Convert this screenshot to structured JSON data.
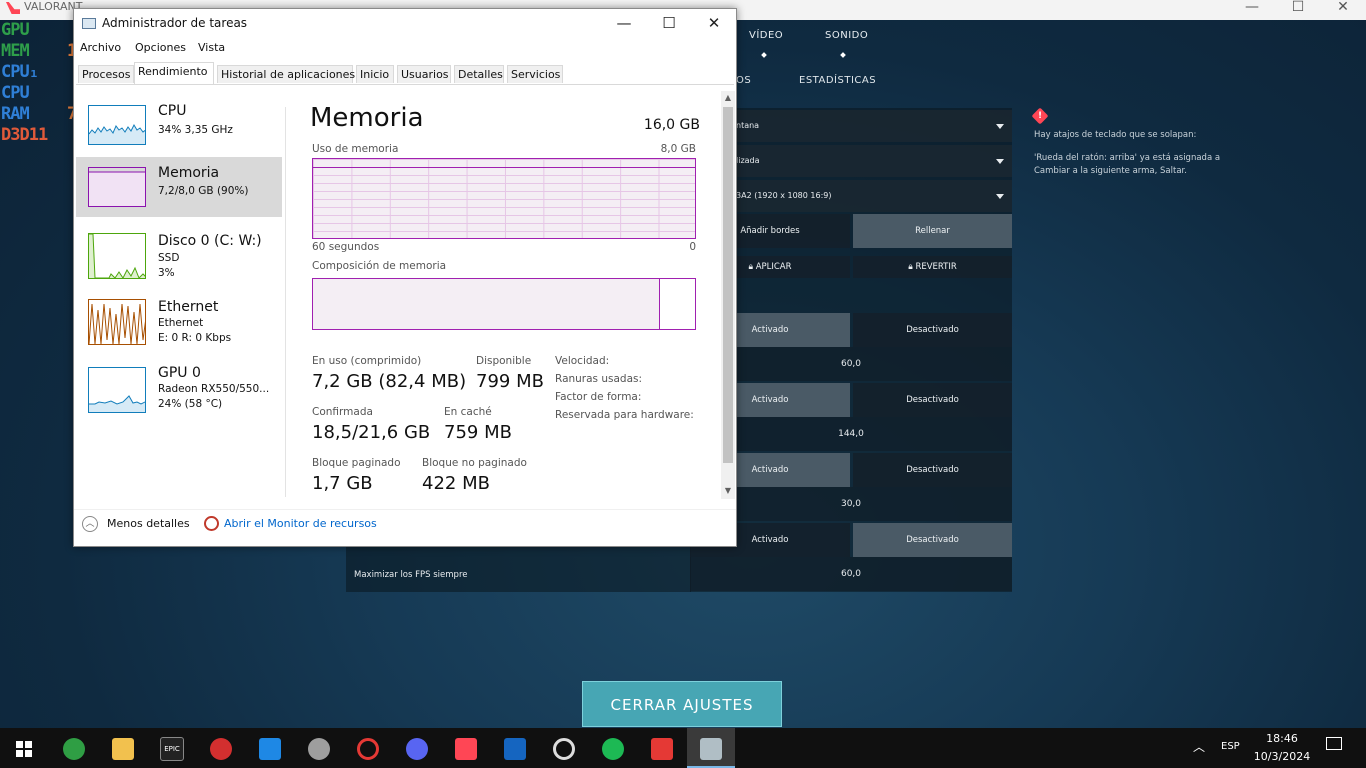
{
  "game": {
    "title": "VALORANT",
    "nav_top": [
      "VÍDEO",
      "SONIDO"
    ],
    "nav_sub": [
      "OS",
      "ESTADÍSTICAS"
    ],
    "dropdowns": [
      "ntana",
      "lizada",
      "3A2 (1920 x  1080 16:9)"
    ],
    "fill_options": {
      "left": "Añadir bordes",
      "right": "Rellenar"
    },
    "apply_label": "APLICAR",
    "revert_label": "REVERTIR",
    "toggle_on": "Activado",
    "toggle_off": "Desactivado",
    "values": [
      "60,0",
      "144,0",
      "30,0",
      "60,0"
    ],
    "max_fps_label": "Maximizar los FPS siempre",
    "warning": {
      "line1": "Hay atajos de teclado que se solapan:",
      "line2": "'Rueda del ratón: arriba' ya está asignada a",
      "line3": "Cambiar a la siguiente arma, Saltar."
    },
    "close_button": "CERRAR AJUSTES",
    "overlay": [
      {
        "label": "GPU",
        "color": "#2e9e4a"
      },
      {
        "label": "MEM",
        "color": "#2e9e4a"
      },
      {
        "label": "CPU₁",
        "color": "#2f7fd6"
      },
      {
        "label": "CPU",
        "color": "#2f7fd6"
      },
      {
        "label": "RAM",
        "color": "#2f7fd6"
      },
      {
        "label": "D3D11",
        "color": "#e05a3a"
      }
    ],
    "overlay_digit_1": "1",
    "overlay_digit_2": "7"
  },
  "taskmanager": {
    "title": "Administrador de tareas",
    "menu": [
      "Archivo",
      "Opciones",
      "Vista"
    ],
    "tabs": [
      "Procesos",
      "Rendimiento",
      "Historial de aplicaciones",
      "Inicio",
      "Usuarios",
      "Detalles",
      "Servicios"
    ],
    "active_tab": "Rendimiento",
    "sidebar": [
      {
        "title": "CPU",
        "sub1": "34% 3,35 GHz",
        "sub2": "",
        "color": "#117dbb"
      },
      {
        "title": "Memoria",
        "sub1": "7,2/8,0 GB (90%)",
        "sub2": "",
        "color": "#8b12ae"
      },
      {
        "title": "Disco 0 (C: W:)",
        "sub1": "SSD",
        "sub2": "3%",
        "color": "#4da60c"
      },
      {
        "title": "Ethernet",
        "sub1": "Ethernet",
        "sub2": "E: 0 R: 0 Kbps",
        "color": "#a74f01"
      },
      {
        "title": "GPU 0",
        "sub1": "Radeon RX550/550...",
        "sub2": "24% (58 °C)",
        "color": "#117dbb"
      }
    ],
    "main": {
      "heading": "Memoria",
      "total": "16,0 GB",
      "usage_label": "Uso de memoria",
      "usage_max": "8,0 GB",
      "time_left": "60 segundos",
      "time_right": "0",
      "composition_label": "Composición de memoria",
      "composition_in_use_fraction": 0.905,
      "stats": {
        "in_use_label": "En uso (comprimido)",
        "in_use_value": "7,2 GB (82,4 MB)",
        "available_label": "Disponible",
        "available_value": "799 MB",
        "committed_label": "Confirmada",
        "committed_value": "18,5/21,6 GB",
        "cached_label": "En caché",
        "cached_value": "759 MB",
        "paged_label": "Bloque paginado",
        "paged_value": "1,7 GB",
        "nonpaged_label": "Bloque no paginado",
        "nonpaged_value": "422 MB"
      },
      "props": [
        "Velocidad:",
        "Ranuras usadas:",
        "Factor de forma:",
        "Reservada para hardware:"
      ]
    },
    "footer": {
      "fewer_details": "Menos detalles",
      "resource_monitor": "Abrir el Monitor de recursos"
    }
  },
  "taskbar": {
    "time": "18:46",
    "date": "10/3/2024",
    "lang": "ESP",
    "epic_label": "EPIC"
  }
}
